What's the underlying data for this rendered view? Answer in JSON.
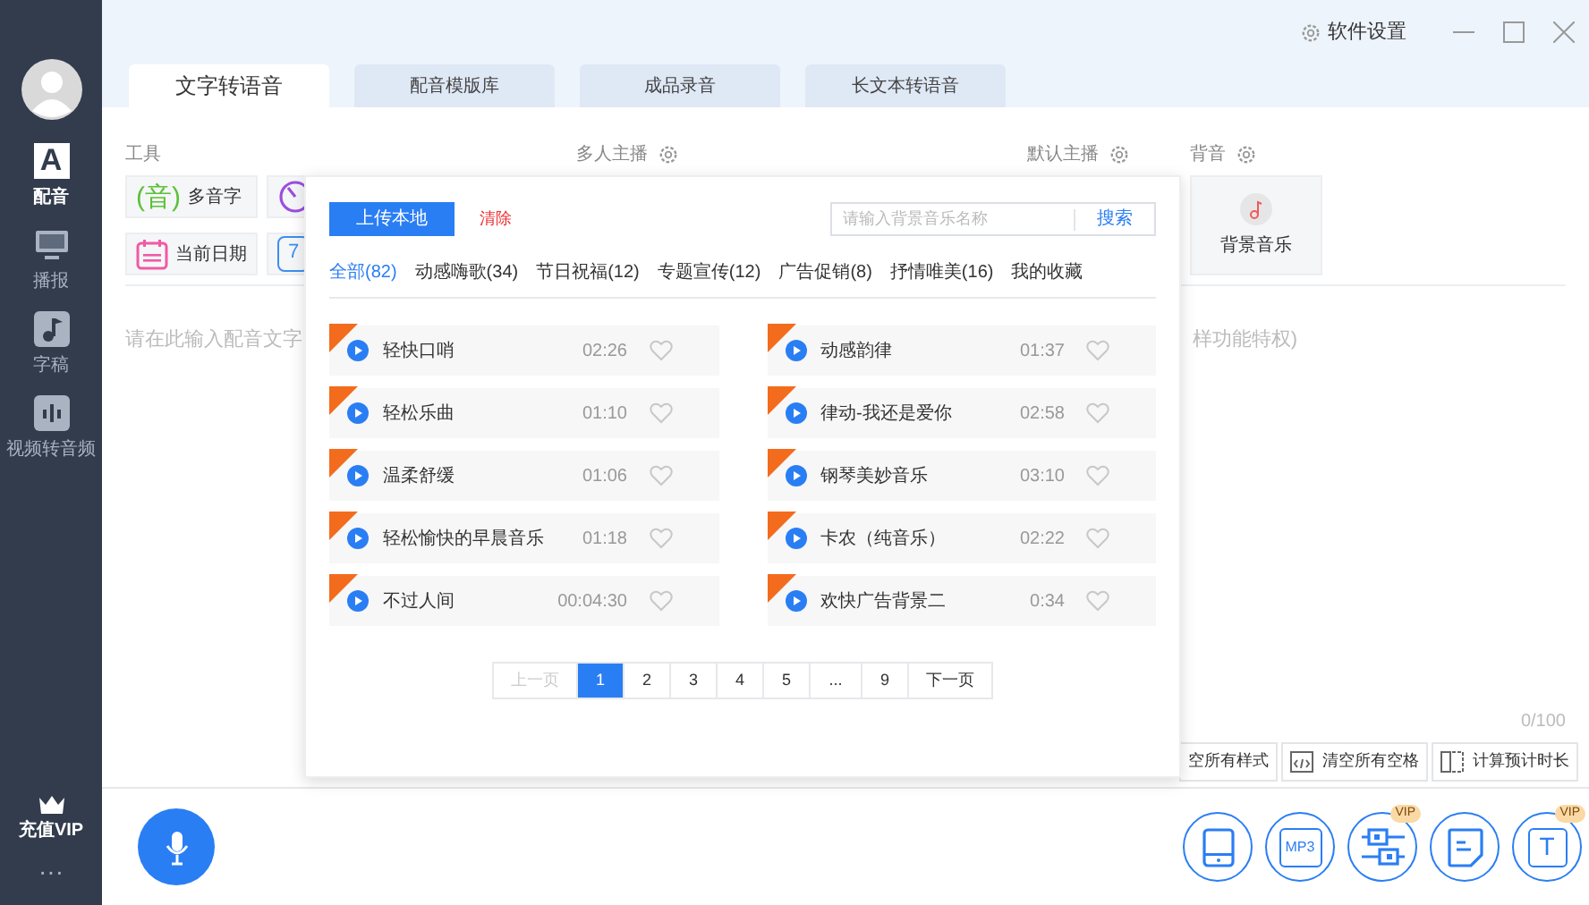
{
  "sidebar": {
    "items": [
      {
        "label": "配音",
        "kind": "letter",
        "glyph": "A",
        "selected": true
      },
      {
        "label": "播报",
        "kind": "monitor",
        "selected": false
      },
      {
        "label": "字稿",
        "kind": "note",
        "selected": false
      },
      {
        "label": "视频转音频",
        "kind": "bars",
        "selected": false
      }
    ],
    "vip": "充值VIP",
    "more": "···"
  },
  "header": {
    "settings": "软件设置"
  },
  "tabs": [
    {
      "label": "文字转语音",
      "selected": true
    },
    {
      "label": "配音模版库",
      "selected": false
    },
    {
      "label": "成品录音",
      "selected": false
    },
    {
      "label": "长文本转语音",
      "selected": false
    }
  ],
  "sections": {
    "tools": "工具",
    "multi": "多人主播",
    "default": "默认主播",
    "bgm": "背音"
  },
  "tools": [
    {
      "label": "多音字",
      "kind": "pinyin",
      "glyph": "(音)"
    },
    {
      "kind": "clock"
    },
    {
      "label": "当前日期",
      "kind": "calendar"
    },
    {
      "kind": "date",
      "glyph": "7"
    }
  ],
  "bgm_card": {
    "label": "背景音乐"
  },
  "editor": {
    "placeholder": "请在此输入配音文字",
    "hint_tail": "样功能特权)",
    "counter": "0/100"
  },
  "editor_buttons": [
    {
      "label": "空所有样式",
      "kind": "style"
    },
    {
      "label": "清空所有空格",
      "kind": "code"
    },
    {
      "label": "计算预计时长",
      "kind": "split"
    }
  ],
  "bottom_buttons": [
    {
      "kind": "tablet"
    },
    {
      "kind": "mp3",
      "text": "MP3"
    },
    {
      "kind": "switches",
      "badge": "VIP"
    },
    {
      "kind": "doc"
    },
    {
      "kind": "text",
      "text": "T",
      "badge": "VIP"
    }
  ],
  "popup": {
    "upload": "上传本地",
    "clear": "清除",
    "search": {
      "placeholder": "请输入背景音乐名称",
      "button": "搜索"
    },
    "categories": [
      {
        "label": "全部(82)",
        "selected": true
      },
      {
        "label": "动感嗨歌(34)",
        "selected": false
      },
      {
        "label": "节日祝福(12)",
        "selected": false
      },
      {
        "label": "专题宣传(12)",
        "selected": false
      },
      {
        "label": "广告促销(8)",
        "selected": false
      },
      {
        "label": "抒情唯美(16)",
        "selected": false
      },
      {
        "label": "我的收藏",
        "selected": false
      }
    ],
    "tracks": [
      {
        "name": "轻快口哨",
        "duration": "02:26",
        "favorite": false
      },
      {
        "name": "动感韵律",
        "duration": "01:37",
        "favorite": false
      },
      {
        "name": "轻松乐曲",
        "duration": "01:10",
        "favorite": false
      },
      {
        "name": "律动-我还是爱你",
        "duration": "02:58",
        "favorite": false
      },
      {
        "name": "温柔舒缓",
        "duration": "01:06",
        "favorite": false
      },
      {
        "name": "钢琴美妙音乐",
        "duration": "03:10",
        "favorite": false
      },
      {
        "name": "轻松愉快的早晨音乐",
        "duration": "01:18",
        "favorite": false
      },
      {
        "name": "卡农（纯音乐）",
        "duration": "02:22",
        "favorite": false
      },
      {
        "name": "不过人间",
        "duration": "00:04:30",
        "favorite": false
      },
      {
        "name": "欢快广告背景二",
        "duration": "0:34",
        "favorite": false
      }
    ],
    "pagination": {
      "prev": {
        "label": "上一页",
        "disabled": true
      },
      "next": {
        "label": "下一页",
        "disabled": false
      },
      "pages": [
        {
          "label": "1",
          "selected": true
        },
        {
          "label": "2",
          "selected": false
        },
        {
          "label": "3",
          "selected": false
        },
        {
          "label": "4",
          "selected": false
        },
        {
          "label": "5",
          "selected": false
        },
        {
          "label": "...",
          "selected": false
        },
        {
          "label": "9",
          "selected": false
        }
      ]
    }
  }
}
